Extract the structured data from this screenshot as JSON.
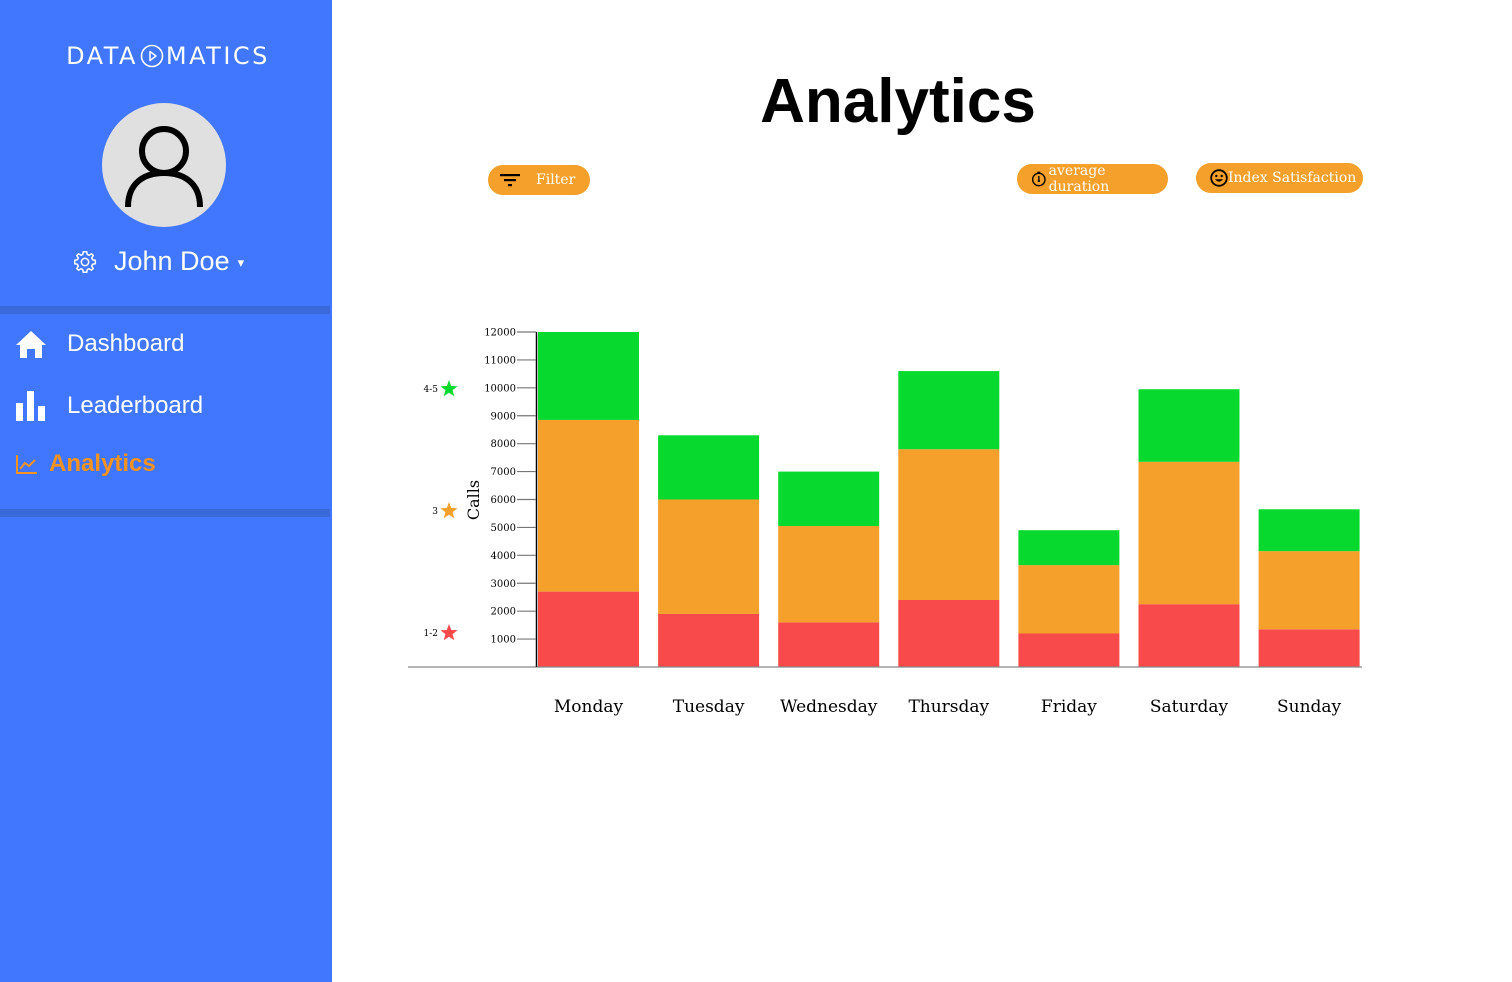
{
  "brand": {
    "left": "DATA",
    "right": "MATICS",
    "logo_icon": "play-circle-icon"
  },
  "user": {
    "name": "John Doe",
    "avatar_icon": "user-icon",
    "settings_icon": "gear-icon",
    "caret": "▾"
  },
  "nav": {
    "items": [
      {
        "label": "Dashboard",
        "icon": "home-icon",
        "active": false
      },
      {
        "label": "Leaderboard",
        "icon": "bar-chart-icon",
        "active": false
      },
      {
        "label": "Analytics",
        "icon": "line-chart-icon",
        "active": true
      }
    ]
  },
  "colors": {
    "sidebar": "#4176fe",
    "accent": "#f7931e",
    "pill": "#f4a02a",
    "low": "#f84a4a",
    "mid": "#f5a02a",
    "high": "#08d92e"
  },
  "page": {
    "title": "Analytics"
  },
  "toolbar": {
    "filter_label": "Filter",
    "duration_label": "average duration",
    "satisfaction_label": "Index Satisfaction"
  },
  "chart_data": {
    "type": "bar",
    "stacked": true,
    "title": "",
    "xlabel": "",
    "ylabel": "Calls",
    "ylim": [
      0,
      12000
    ],
    "yticks": [
      1000,
      2000,
      3000,
      4000,
      5000,
      6000,
      7000,
      8000,
      9000,
      10000,
      11000,
      12000
    ],
    "categories": [
      "Monday",
      "Tuesday",
      "Wednesday",
      "Thursday",
      "Friday",
      "Saturday",
      "Sunday"
    ],
    "series": [
      {
        "name": "1-2",
        "color": "#f84a4a",
        "values": [
          2700,
          1900,
          1600,
          2400,
          1200,
          2250,
          1350
        ]
      },
      {
        "name": "3",
        "color": "#f5a02a",
        "values": [
          6150,
          4100,
          3450,
          5400,
          2450,
          5100,
          2800
        ]
      },
      {
        "name": "4-5",
        "color": "#08d92e",
        "values": [
          3150,
          2300,
          1950,
          2800,
          1250,
          2600,
          1500
        ]
      }
    ],
    "legend": {
      "placement": "left",
      "entries": [
        {
          "label": "4-5",
          "icon": "star-icon",
          "color": "#08d92e"
        },
        {
          "label": "3",
          "icon": "star-icon",
          "color": "#f5a02a"
        },
        {
          "label": "1-2",
          "icon": "star-icon",
          "color": "#f84a4a"
        }
      ]
    },
    "grid": false
  }
}
